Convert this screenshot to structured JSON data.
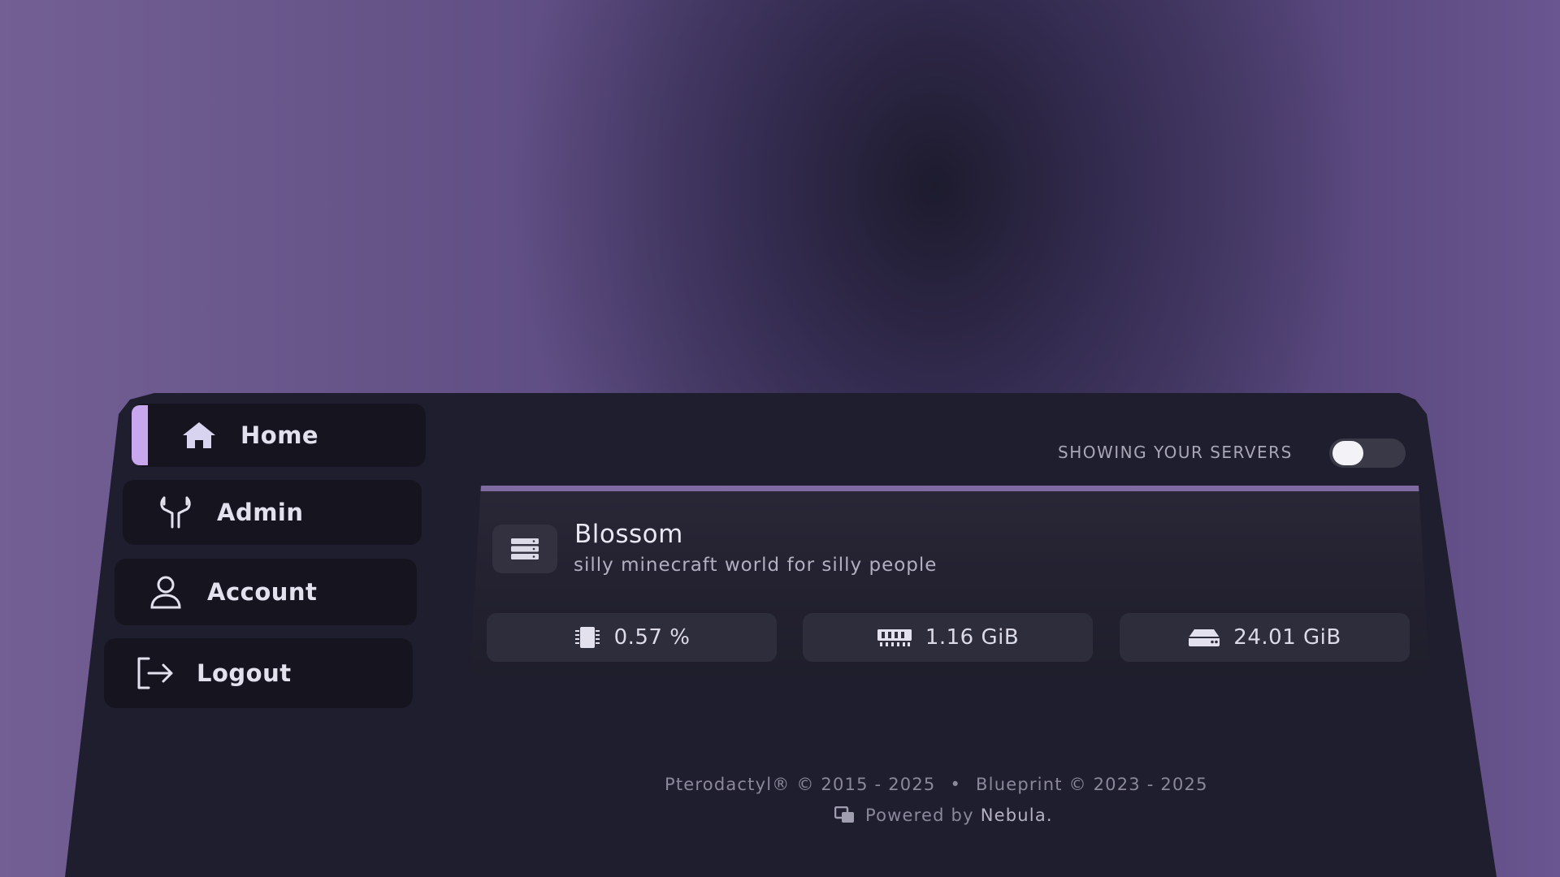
{
  "sidebar": {
    "items": [
      {
        "label": "Home",
        "icon": "home-icon",
        "active": true
      },
      {
        "label": "Admin",
        "icon": "wrench-icon",
        "active": false
      },
      {
        "label": "Account",
        "icon": "user-icon",
        "active": false
      },
      {
        "label": "Logout",
        "icon": "logout-icon",
        "active": false
      }
    ]
  },
  "header": {
    "toggle_label": "SHOWING YOUR SERVERS",
    "toggle_state": "off"
  },
  "server": {
    "name": "Blossom",
    "description": "silly minecraft world for silly people",
    "icon": "server-icon",
    "stats": {
      "cpu": "0.57 %",
      "memory": "1.16 GiB",
      "disk": "24.01 GiB"
    }
  },
  "footer": {
    "copyright_pterodactyl": "Pterodactyl® © 2015 - 2025",
    "separator": "•",
    "copyright_blueprint": "Blueprint © 2023 - 2025",
    "powered_by": "Powered by",
    "powered_brand": "Nebula."
  },
  "colors": {
    "panel": "#1f1e2e",
    "nav_item": "#16151f",
    "accent": "#c9a7ee",
    "card_topline": "#7f6aa1",
    "stat_bg": "#2e2d3b"
  }
}
